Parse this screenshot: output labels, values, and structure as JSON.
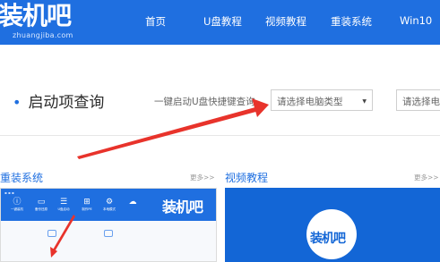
{
  "header": {
    "logo_text": "装机吧",
    "logo_sub": "zhuangjiba.com",
    "nav": [
      "首页",
      "U盘教程",
      "视频教程",
      "重装系统",
      "Win10"
    ]
  },
  "query": {
    "title": "启动项查询",
    "label": "一键启动U盘快捷键查询",
    "select1": "请选择电脑类型",
    "select2": "请选择电"
  },
  "sections": {
    "left_title": "重装系统",
    "left_more": "更多>>",
    "right_title": "视频教程",
    "right_more": "更多>>"
  },
  "thumb_left": {
    "logo": "装机吧",
    "items": [
      "一键装机",
      "备份还原",
      "U盘启动",
      "制作PE",
      "本地模式"
    ]
  },
  "thumb_right": {
    "logo": "装机吧"
  },
  "colors": {
    "brand_blue": "#1f6fe0",
    "arrow_red": "#e8332b"
  }
}
